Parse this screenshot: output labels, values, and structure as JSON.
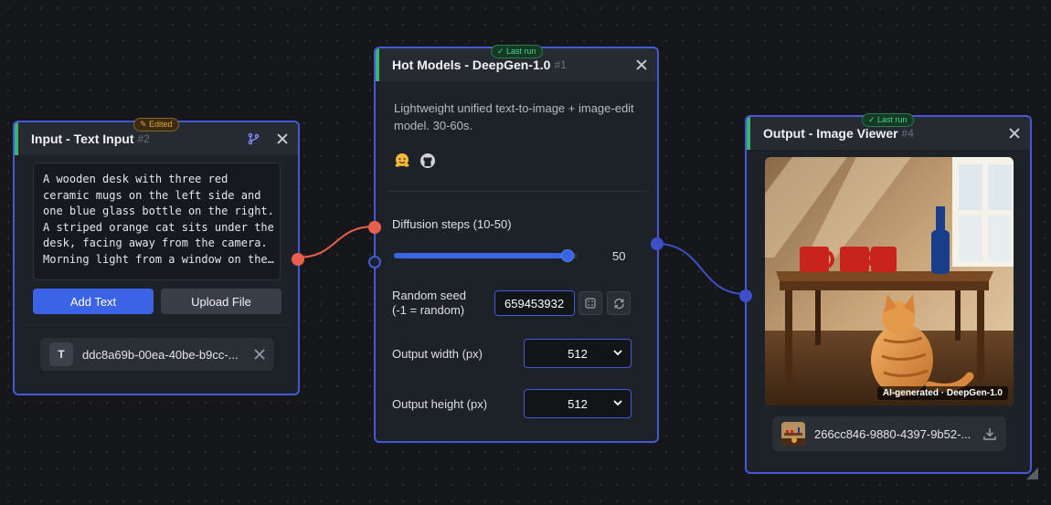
{
  "nodes": {
    "input": {
      "title": "Input - Text Input",
      "num": "#2",
      "badge": "✎ Edited",
      "text": "A wooden desk with three red\nceramic mugs on the left side and\none blue glass bottle on the right.\nA striped orange cat sits under the\ndesk, facing away from the camera.\nMorning light from a window on the…",
      "add_text_label": "Add Text",
      "upload_label": "Upload File",
      "file_icon_letter": "T",
      "file_name": "ddc8a69b-00ea-40be-b9cc-..."
    },
    "model": {
      "title": "Hot Models - DeepGen-1.0",
      "num": "#1",
      "badge": "✓ Last run",
      "description": "Lightweight unified text-to-image + image-edit model. 30-60s.",
      "steps_label": "Diffusion steps (10-50)",
      "steps_value": "50",
      "steps_fraction": 0.95,
      "seed_label": "Random seed (-1 = random)",
      "seed_value": "659453932",
      "width_label": "Output width (px)",
      "width_value": "512",
      "height_label": "Output height (px)",
      "height_value": "512"
    },
    "output": {
      "title": "Output - Image Viewer",
      "num": "#4",
      "badge": "✓ Last run",
      "watermark": "AI-generated · DeepGen-1.0",
      "file_name": "266cc846-9880-4397-9b52-..."
    }
  },
  "colors": {
    "accent": "#3a63e6",
    "node_border": "#4458d8",
    "header_stripe": "#3bb372",
    "wire_text": "#e8604c",
    "wire_image": "#3d50c8"
  },
  "icons": [
    "hugging-face-icon",
    "github-icon",
    "dice-icon",
    "refresh-icon",
    "download-icon",
    "branch-icon",
    "close-icon",
    "chevron-down-icon"
  ]
}
